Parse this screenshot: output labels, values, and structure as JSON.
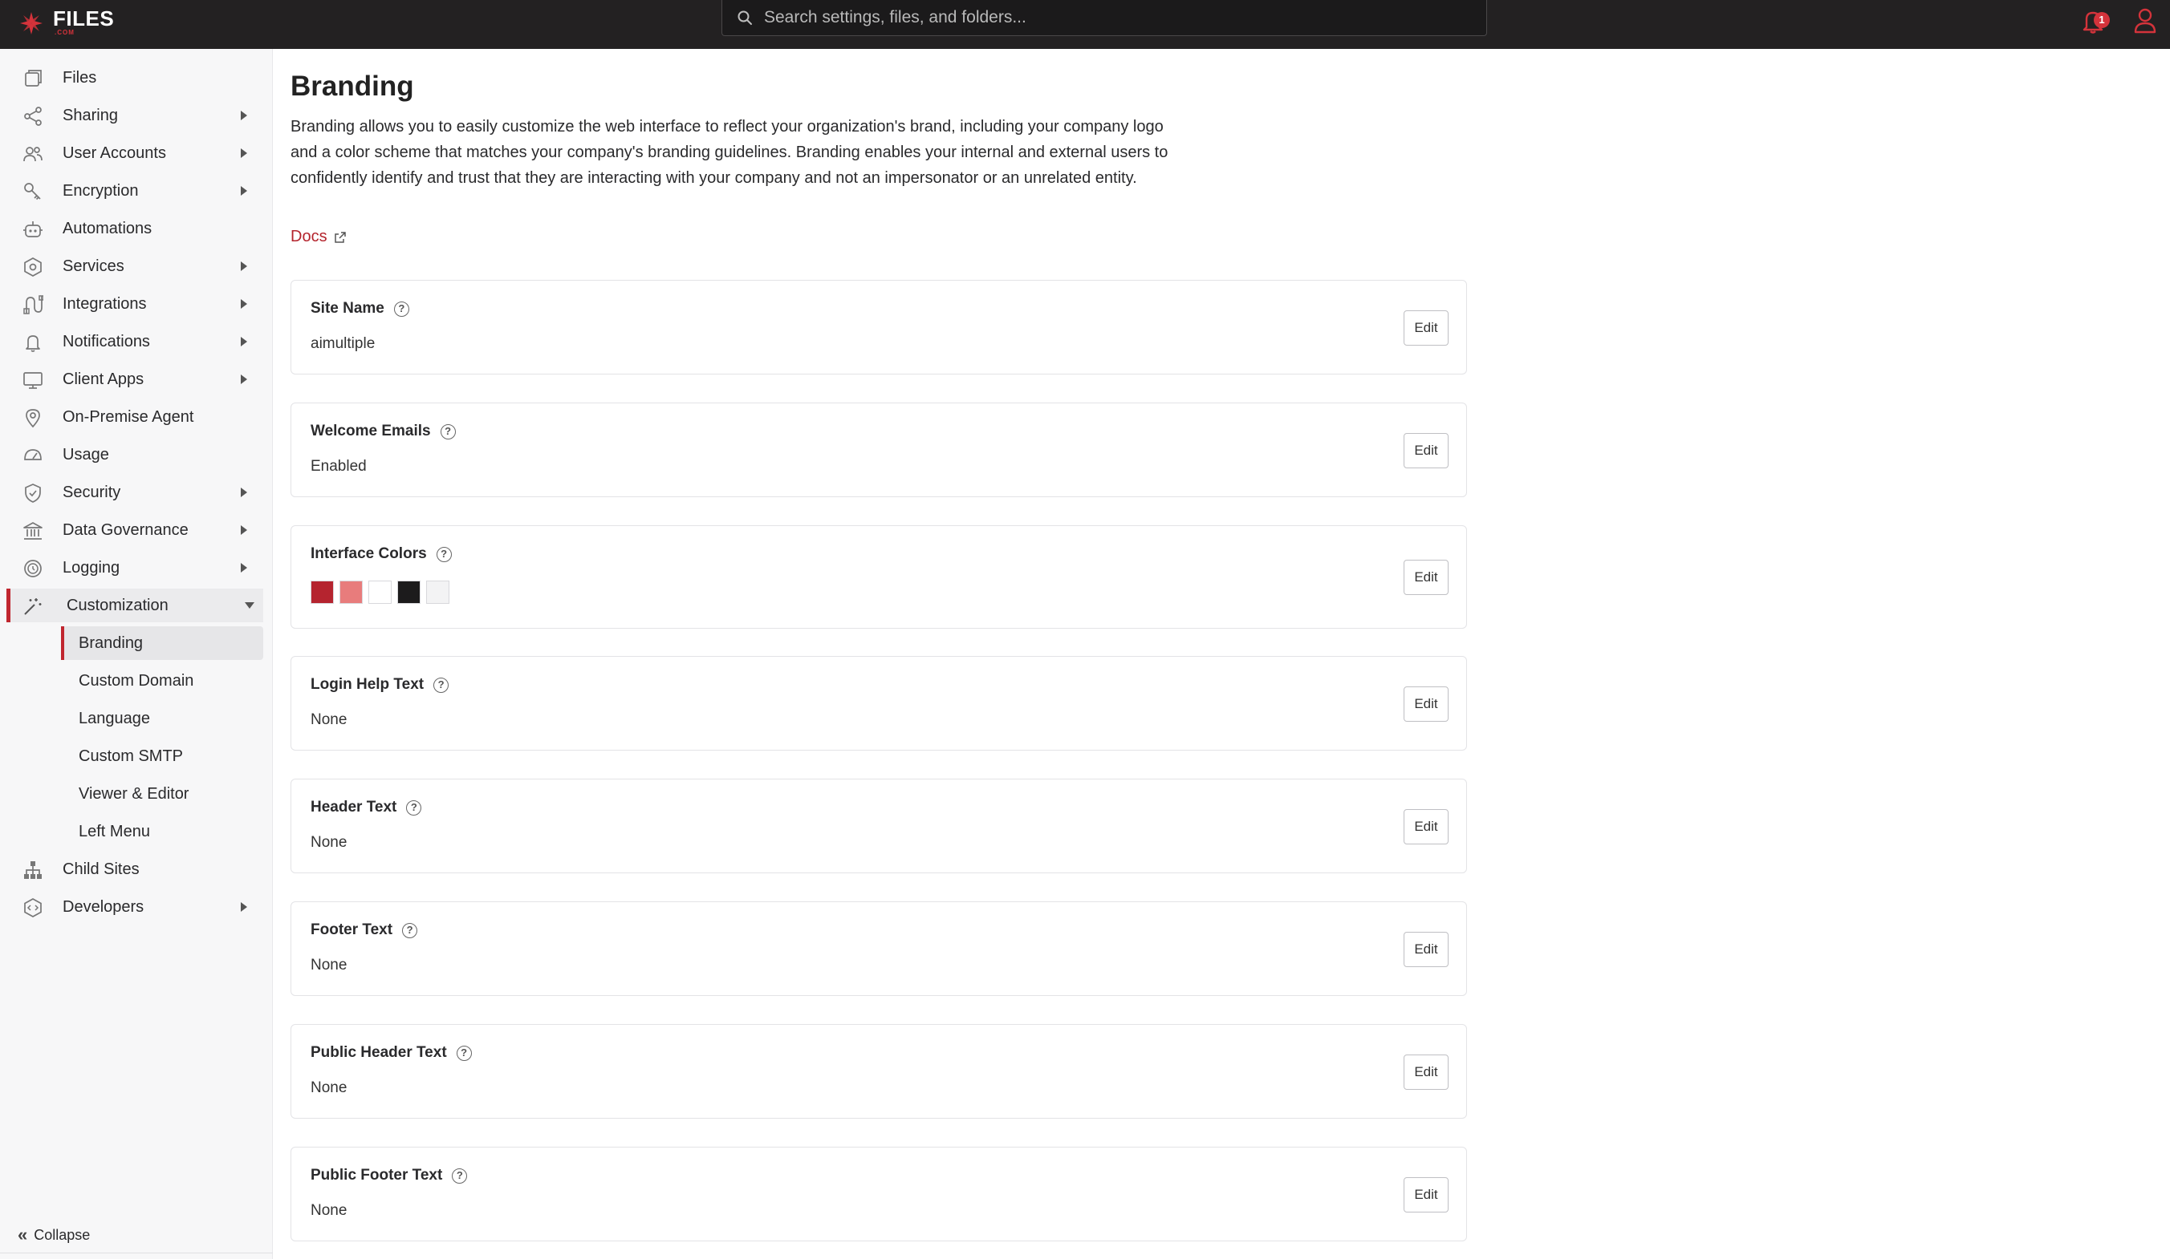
{
  "topbar": {
    "logo_text": "FILES",
    "logo_sub": ".COM",
    "search_placeholder": "Search settings, files, and folders...",
    "notification_count": "1"
  },
  "sidebar": {
    "items": [
      {
        "label": "Files",
        "icon": "files-icon",
        "has_arrow": false
      },
      {
        "label": "Sharing",
        "icon": "share-icon",
        "has_arrow": true
      },
      {
        "label": "User Accounts",
        "icon": "users-icon",
        "has_arrow": true
      },
      {
        "label": "Encryption",
        "icon": "key-icon",
        "has_arrow": true
      },
      {
        "label": "Automations",
        "icon": "robot-icon",
        "has_arrow": false
      },
      {
        "label": "Services",
        "icon": "services-icon",
        "has_arrow": true
      },
      {
        "label": "Integrations",
        "icon": "integrations-icon",
        "has_arrow": true
      },
      {
        "label": "Notifications",
        "icon": "bell-icon",
        "has_arrow": true
      },
      {
        "label": "Client Apps",
        "icon": "monitor-icon",
        "has_arrow": true
      },
      {
        "label": "On-Premise Agent",
        "icon": "location-pin-icon",
        "has_arrow": false
      },
      {
        "label": "Usage",
        "icon": "gauge-icon",
        "has_arrow": false
      },
      {
        "label": "Security",
        "icon": "shield-icon",
        "has_arrow": true
      },
      {
        "label": "Data Governance",
        "icon": "bank-icon",
        "has_arrow": true
      },
      {
        "label": "Logging",
        "icon": "clock-icon",
        "has_arrow": true
      },
      {
        "label": "Customization",
        "icon": "magic-wand-icon",
        "has_arrow": true,
        "active": true
      }
    ],
    "sub_items": [
      {
        "label": "Branding",
        "active": true
      },
      {
        "label": "Custom Domain"
      },
      {
        "label": "Language"
      },
      {
        "label": "Custom SMTP"
      },
      {
        "label": "Viewer & Editor"
      },
      {
        "label": "Left Menu"
      }
    ],
    "after_items": [
      {
        "label": "Child Sites",
        "icon": "sitemap-icon",
        "has_arrow": false
      },
      {
        "label": "Developers",
        "icon": "code-icon",
        "has_arrow": true
      }
    ],
    "collapse_label": "Collapse"
  },
  "main": {
    "title": "Branding",
    "description": "Branding allows you to easily customize the web interface to reflect your organization's brand, including your company logo and a color scheme that matches your company's branding guidelines. Branding enables your internal and external users to confidently identify and trust that they are interacting with your company and not an impersonator or an unrelated entity.",
    "docs_label": "Docs",
    "edit_label": "Edit",
    "cards": [
      {
        "label": "Site Name",
        "value": "aimultiple"
      },
      {
        "label": "Welcome Emails",
        "value": "Enabled"
      },
      {
        "label": "Interface Colors",
        "colors": [
          "#b5242f",
          "#e87c7c",
          "#ffffff",
          "#1c1b1c",
          "#f3f3f4"
        ]
      },
      {
        "label": "Login Help Text",
        "value": "None"
      },
      {
        "label": "Header Text",
        "value": "None"
      },
      {
        "label": "Footer Text",
        "value": "None"
      },
      {
        "label": "Public Header Text",
        "value": "None"
      },
      {
        "label": "Public Footer Text",
        "value": "None"
      }
    ]
  }
}
